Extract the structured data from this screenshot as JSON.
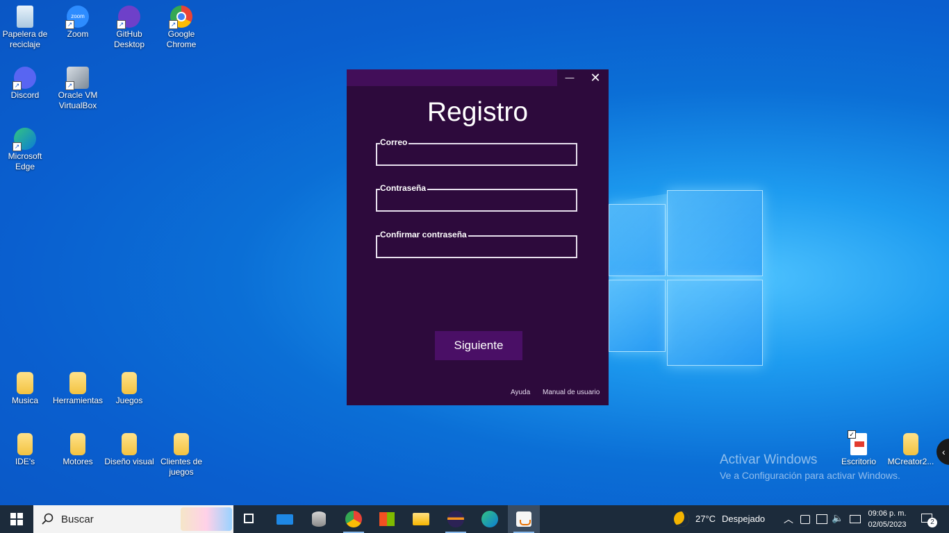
{
  "desktop": {
    "icons": [
      {
        "label": "Papelera de reciclaje",
        "icon": "recycle-bin-icon"
      },
      {
        "label": "Zoom",
        "icon": "zoom-icon"
      },
      {
        "label": "GitHub Desktop",
        "icon": "github-icon"
      },
      {
        "label": "Google Chrome",
        "icon": "chrome-icon"
      },
      {
        "label": "Discord",
        "icon": "discord-icon"
      },
      {
        "label": "Oracle VM VirtualBox",
        "icon": "virtualbox-icon"
      },
      {
        "label": "Microsoft Edge",
        "icon": "edge-icon"
      },
      {
        "label": "Musica",
        "icon": "folder-icon"
      },
      {
        "label": "Herramientas",
        "icon": "folder-icon"
      },
      {
        "label": "Juegos",
        "icon": "folder-icon"
      },
      {
        "label": "IDE's",
        "icon": "folder-icon"
      },
      {
        "label": "Motores",
        "icon": "folder-icon"
      },
      {
        "label": "Diseño visual",
        "icon": "folder-icon"
      },
      {
        "label": "Clientes de juegos",
        "icon": "folder-icon"
      },
      {
        "label": "Escritorio",
        "icon": "pdf-icon"
      },
      {
        "label": "MCreator2...",
        "icon": "folder-icon"
      }
    ],
    "zoom_icon_text": "zoom"
  },
  "window": {
    "title": "Registro",
    "minimize_glyph": "—",
    "close_glyph": "✕",
    "fields": [
      {
        "label": "Correo",
        "value": ""
      },
      {
        "label": "Contraseña",
        "value": ""
      },
      {
        "label": "Confirmar contraseña",
        "value": ""
      }
    ],
    "next_button": "Siguiente",
    "footer": {
      "help": "Ayuda",
      "manual": "Manual de usuario"
    },
    "colors": {
      "background": "#2d0a3c",
      "titlebar": "#420e59",
      "button": "#4a0f66"
    }
  },
  "watermark": {
    "title": "Activar Windows",
    "subtitle": "Ve a Configuración para activar Windows."
  },
  "taskbar": {
    "search_placeholder": "Buscar",
    "apps": [
      "task-view-icon",
      "mail-icon",
      "database-icon",
      "chrome-icon",
      "store-icon",
      "file-explorer-icon",
      "eclipse-icon",
      "edge-icon",
      "java-icon"
    ],
    "weather": {
      "temp": "27°C",
      "condition": "Despejado"
    },
    "time": "09:06 p. m.",
    "date": "02/05/2023",
    "notifications": "2"
  }
}
